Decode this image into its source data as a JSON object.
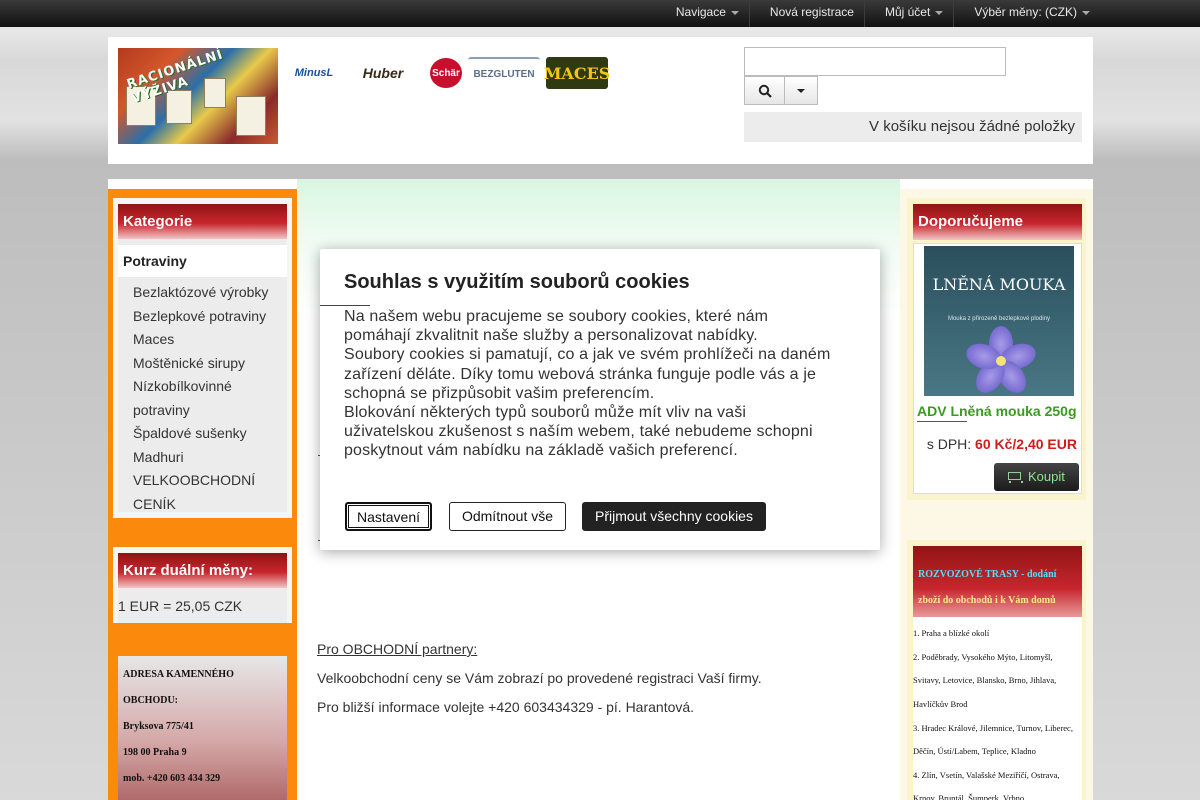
{
  "topnav": {
    "items": [
      {
        "label": "Navigace",
        "dropdown": true
      },
      {
        "label": "Nová registrace",
        "dropdown": false
      },
      {
        "label": "Můj účet",
        "dropdown": true
      },
      {
        "label": "Výběr měny: (CZK)",
        "dropdown": true
      }
    ]
  },
  "header": {
    "shop_photo_text": "RACIONÁLNÍ VÝŽIVA",
    "brands": [
      "MinusL",
      "Huber",
      "Schär",
      "BEZGLUTEN",
      "MACES"
    ],
    "search": {
      "value": "",
      "placeholder": ""
    },
    "cart_status": "V košíku nejsou žádné položky"
  },
  "left": {
    "categories_title": "Kategorie",
    "categories_top": "Potraviny",
    "categories": [
      "Bezlaktózové výrobky",
      "Bezlepkové potraviny",
      "Maces",
      "Moštěnické sirupy",
      "Nízkobílkovinné potraviny",
      "Špaldové sušenky",
      "Madhuri",
      "VELKOOBCHODNÍ CENÍK"
    ],
    "currency_title": "Kurz duální měny:",
    "currency_rate": "1 EUR = 25,05 CZK",
    "address": [
      "ADRESA KAMENNÉHO",
      "OBCHODU:",
      "Bryksova 775/41",
      "198 00 Praha 9",
      "mob. +420 603 434 329"
    ]
  },
  "right": {
    "recommend_title": "Doporučujeme",
    "product": {
      "image_title": "LNĚNÁ MOUKA",
      "image_subtitle": "Mouka z přirozeně bezlepkové plodiny",
      "name": "ADV Lněná mouka 250g",
      "price_label": "s DPH:",
      "price": "60 Kč/2,40 EUR",
      "buy_label": "Koupit"
    },
    "routes_title_1": "ROZVOZOVÉ  TRASY - dodání",
    "routes_title_2": "zboží do obchodů i k Vám domů",
    "routes": [
      "1. Praha a blízké okolí",
      "2. Poděbrady, Vysokého Mýto, Litomyšl,",
      "Svitavy, Letovice, Blansko, Brno, Jihlava,",
      "Havlíčkův Brod",
      "3. Hradec Králové, Jilemnice, Turnov, Liberec,",
      "Děčín, Ústí/Labem, Teplice, Kladno",
      "4. Zlín, Vsetín, Valašské Meziříčí, Ostrava,",
      "Krnov, Bruntál, Šumperk, Vrbno"
    ]
  },
  "center": {
    "partners_title": "Pro OBCHODNÍ  partnery:",
    "partners_line1": "Velkoobchodní ceny se Vám zobrazí po provedené registraci Vaší firmy.",
    "partners_line2": "Pro bližší informace volejte  +420 603434329 - pí. Harantová."
  },
  "cookie": {
    "title": "Souhlas s využitím souborů cookies",
    "text_lines": [
      "Na našem webu pracujeme se soubory cookies, které nám",
      "pomáhají zkvalitnit naše služby a personalizovat nabídky.",
      "Soubory cookies si pamatují, co a jak ve svém prohlížeči na daném",
      "zařízení děláte. Díky tomu webová stránka funguje podle vás a je",
      "schopná se přizpůsobit vašim preferencím.",
      "Blokování některých typů souborů může mít vliv na vaši",
      "uživatelskou zkušenost s naším webem, také nebudeme schopni",
      "poskytnout vám nabídku na základě vašich preferencí."
    ],
    "btn_settings": "Nastavení",
    "btn_reject": "Odmítnout vše",
    "btn_accept": "Přijmout všechny cookies"
  },
  "colors": {
    "accent_orange": "#fb8a0c",
    "header_red": "#c8262e",
    "product_green": "#3a9b1e",
    "price_red": "#d21b1b"
  }
}
